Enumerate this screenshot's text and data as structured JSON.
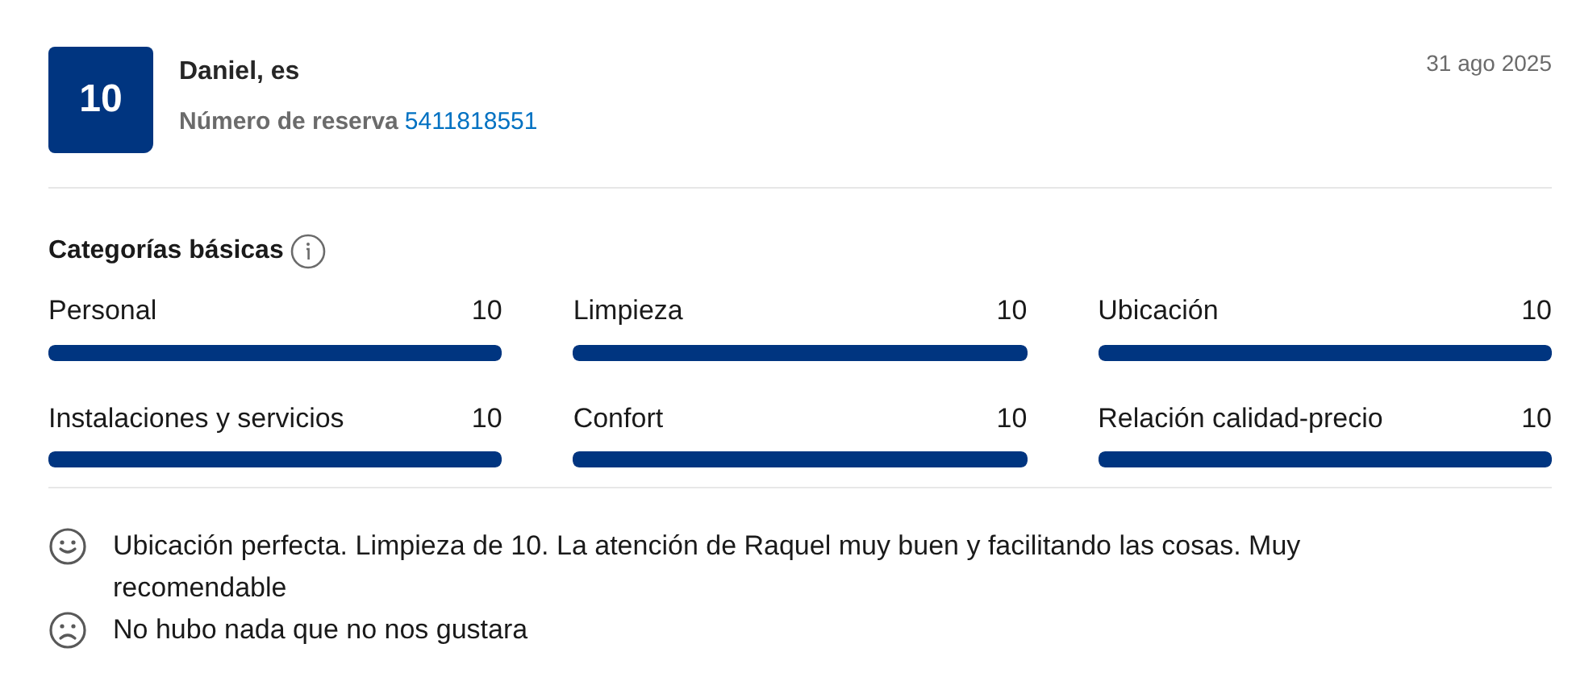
{
  "review": {
    "score": "10",
    "reviewer": "Daniel, es",
    "booking_label": "Número de reserva",
    "booking_number": "5411818551",
    "date": "31 ago 2025"
  },
  "categories": {
    "title": "Categorías básicas",
    "items": [
      {
        "name": "Personal",
        "score": "10",
        "level": 1
      },
      {
        "name": "Limpieza",
        "score": "10",
        "level": 1
      },
      {
        "name": "Ubicación",
        "score": "10",
        "level": 1
      },
      {
        "name": "Instalaciones y servicios",
        "score": "10",
        "level": 1
      },
      {
        "name": "Confort",
        "score": "10",
        "level": 1
      },
      {
        "name": "Relación calidad-precio",
        "score": "10",
        "level": 1
      }
    ]
  },
  "comments": [
    {
      "kind": "positive",
      "text": "Ubicación perfecta. Limpieza de 10. La atención de Raquel muy buen y facilitando las cosas. Muy recomendable"
    },
    {
      "kind": "negative",
      "text": "No hubo nada que no nos gustara"
    }
  ]
}
